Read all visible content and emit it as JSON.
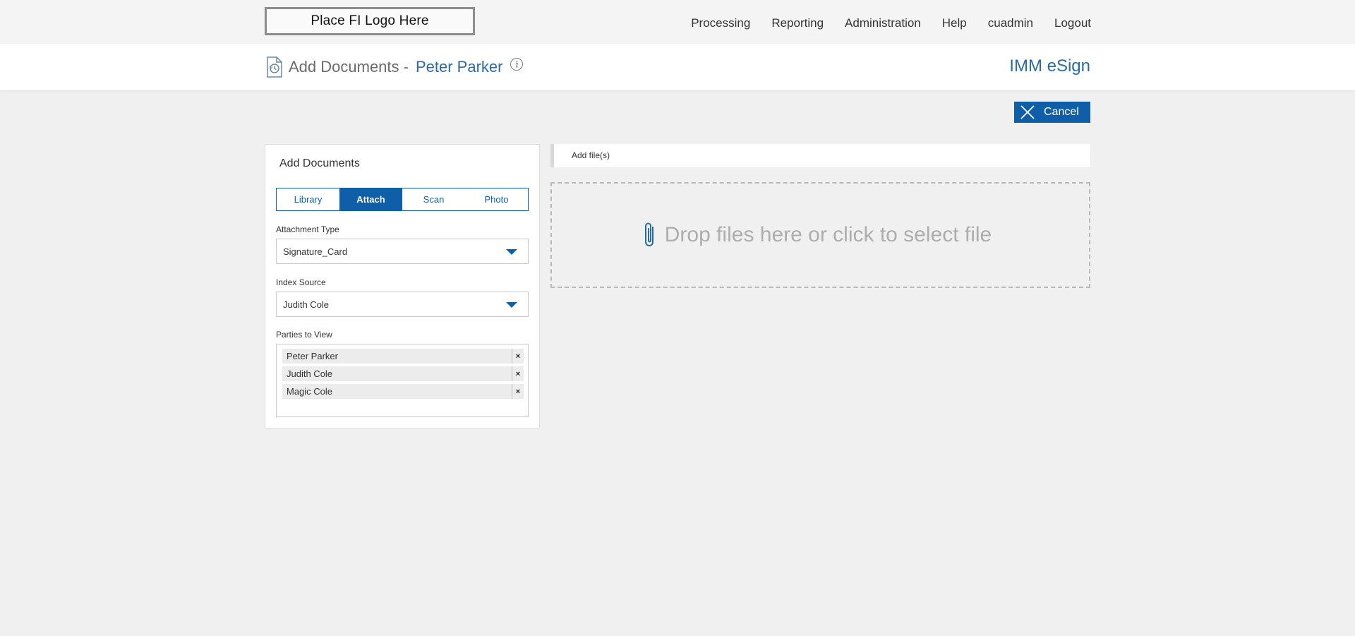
{
  "logo": {
    "text": "Place FI Logo Here"
  },
  "nav": {
    "items": [
      "Processing",
      "Reporting",
      "Administration",
      "Help",
      "cuadmin",
      "Logout"
    ]
  },
  "header": {
    "title": "Add Documents -",
    "customer_name": "Peter Parker",
    "brand": "IMM eSign"
  },
  "actions": {
    "cancel_label": "Cancel"
  },
  "panel": {
    "title": "Add Documents",
    "tabs": [
      "Library",
      "Attach",
      "Scan",
      "Photo"
    ],
    "active_tab": "Attach",
    "attachment_type": {
      "label": "Attachment Type",
      "value": "Signature_Card"
    },
    "index_source": {
      "label": "Index Source",
      "value": "Judith Cole"
    },
    "parties": {
      "label": "Parties to View",
      "items": [
        "Peter Parker",
        "Judith Cole",
        "Magic Cole"
      ],
      "remove_symbol": "×"
    }
  },
  "files": {
    "bar_label": "Add file(s)",
    "dropzone_text": "Drop files here or click to select file"
  },
  "icons": {
    "page_icon": "document-history-icon",
    "info_icon": "info-icon",
    "cancel_icon": "close-icon",
    "dropzone_icon": "paperclip-icon"
  },
  "colors": {
    "accent": "#0f5ea8",
    "brand_text": "#2a6ba6",
    "background": "#f0f0f0"
  }
}
